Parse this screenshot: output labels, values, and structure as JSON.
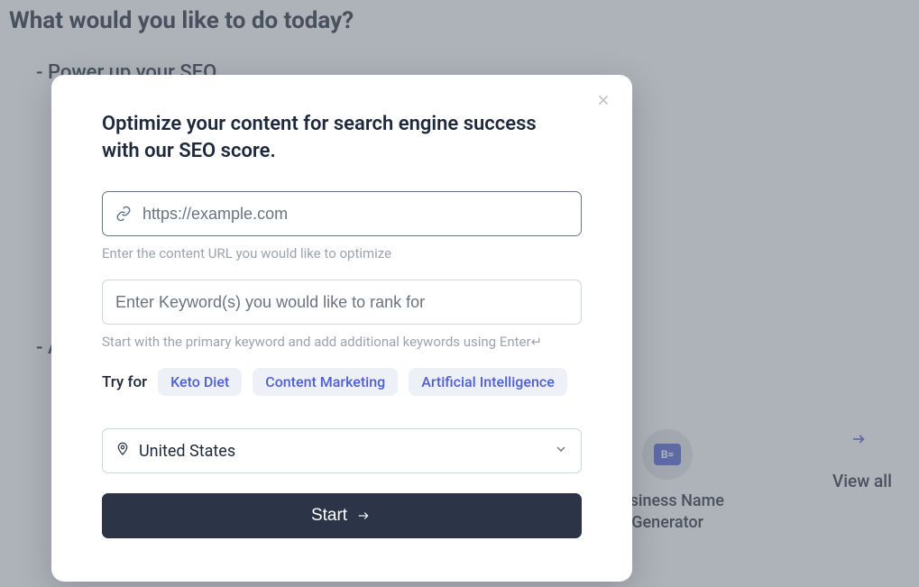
{
  "background": {
    "title": "What would you like to do today?",
    "list_items": [
      "- Power up your SEO",
      "- A"
    ],
    "tool": {
      "name": "Business Name Generator",
      "icon_text": "B="
    },
    "view_all": "View all"
  },
  "modal": {
    "title": "Optimize your content for search engine success with our SEO score.",
    "url_input": {
      "placeholder": "https://example.com",
      "value": "",
      "hint": "Enter the content URL you would like to optimize"
    },
    "keyword_input": {
      "placeholder": "Enter Keyword(s) you would like to rank for",
      "value": "",
      "hint": "Start with the primary keyword and add additional keywords using Enter↵"
    },
    "try_for": {
      "label": "Try for",
      "chips": [
        "Keto Diet",
        "Content Marketing",
        "Artificial Intelligence"
      ]
    },
    "location_select": {
      "value": "United States"
    },
    "start_button": "Start"
  }
}
